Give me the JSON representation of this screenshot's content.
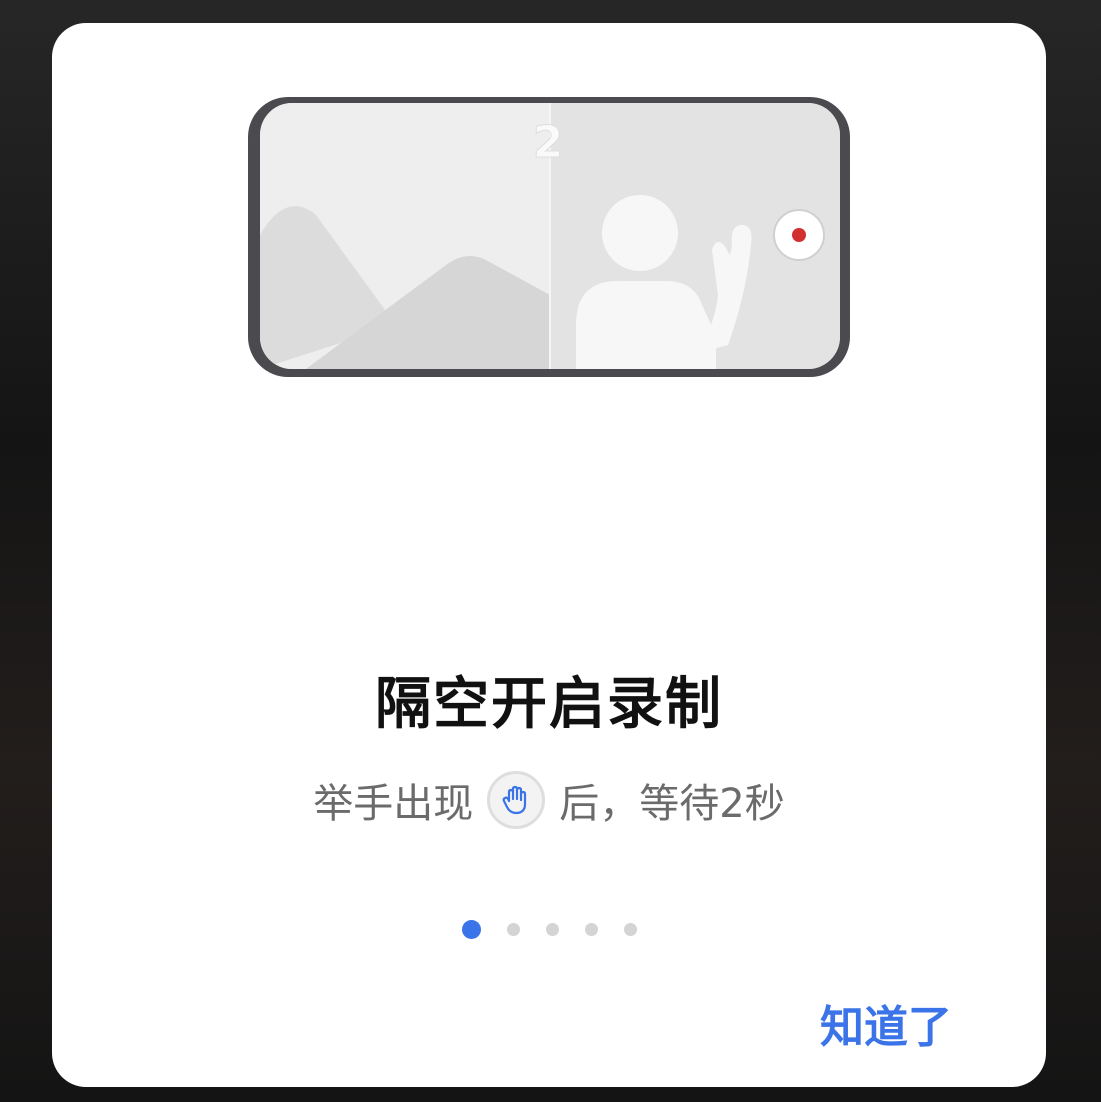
{
  "dialog": {
    "illustration": {
      "countdown": "2",
      "record_color": "#d32f2f"
    },
    "title": "隔空开启录制",
    "subtitle": {
      "before": "举手出现",
      "icon": "raised-hand-icon",
      "after": "后，等待2秒"
    },
    "pager": {
      "total": 5,
      "active_index": 0
    },
    "confirm_label": "知道了",
    "accent_color": "#3b74e8"
  }
}
